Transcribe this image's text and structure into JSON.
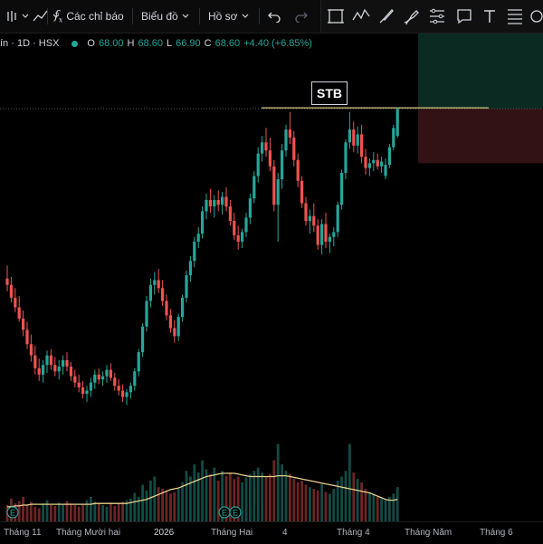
{
  "toolbar": {
    "indicators_label": "Các chỉ báo",
    "chart_label": "Biểu đồ",
    "profile_label": "Hồ sơ"
  },
  "legend": {
    "symbol": "ín · 1D · HSX",
    "o_label": "O",
    "o_value": "68.00",
    "h_label": "H",
    "h_value": "68.60",
    "l_label": "L",
    "l_value": "66.90",
    "c_label": "C",
    "c_value": "68.60",
    "change": "+4.40 (+6.85%)"
  },
  "colors": {
    "up": "#26a69a",
    "down": "#ef5350",
    "ma": "#e8cf8a",
    "target_zone": "#0b2a22",
    "stop_zone": "#331216",
    "entry_line": "#d8c77a"
  },
  "icons": [
    "trend-line-icon",
    "fx-icon",
    "undo-icon",
    "redo-icon",
    "crosshair-box-icon",
    "path-icon",
    "brush-icon",
    "pen-icon",
    "pattern-icon",
    "comment-icon",
    "text-icon",
    "fib-icon",
    "shapes-icon"
  ],
  "chart_data": {
    "type": "candlestick",
    "ticker_label": "STB",
    "x_labels": [
      "Tháng 11",
      "Tháng Mười hai",
      "2026",
      "Tháng Hai",
      "4",
      "Tháng 4",
      "Tháng Năm",
      "Tháng 6"
    ],
    "dividend_marker": "E",
    "price_min": 46,
    "price_max": 72,
    "entry_price": 68.6,
    "target_zone": [
      68.6,
      76
    ],
    "stop_zone": [
      65.2,
      68.6
    ],
    "candles": [
      [
        58.0,
        58.8,
        57.2,
        57.6
      ],
      [
        57.6,
        58.1,
        56.5,
        56.8
      ],
      [
        56.8,
        57.4,
        55.9,
        56.2
      ],
      [
        56.2,
        56.9,
        55.3,
        55.5
      ],
      [
        55.5,
        56.0,
        54.4,
        54.8
      ],
      [
        54.8,
        55.3,
        53.6,
        53.9
      ],
      [
        53.9,
        54.5,
        52.8,
        53.2
      ],
      [
        53.2,
        53.8,
        52.0,
        52.4
      ],
      [
        52.4,
        53.0,
        51.6,
        52.0
      ],
      [
        52.0,
        52.9,
        51.5,
        52.6
      ],
      [
        52.6,
        53.5,
        52.1,
        53.2
      ],
      [
        53.2,
        53.6,
        52.3,
        52.6
      ],
      [
        52.6,
        53.1,
        51.9,
        52.2
      ],
      [
        52.2,
        52.9,
        51.7,
        52.5
      ],
      [
        52.5,
        53.2,
        52.0,
        52.9
      ],
      [
        52.9,
        53.4,
        52.2,
        52.5
      ],
      [
        52.5,
        52.8,
        51.6,
        51.9
      ],
      [
        51.9,
        52.3,
        51.2,
        51.5
      ],
      [
        51.5,
        52.0,
        50.9,
        51.2
      ],
      [
        51.2,
        51.6,
        50.5,
        50.8
      ],
      [
        50.8,
        51.3,
        50.3,
        51.0
      ],
      [
        51.0,
        51.8,
        50.6,
        51.5
      ],
      [
        51.5,
        52.3,
        51.1,
        52.0
      ],
      [
        52.0,
        52.4,
        51.4,
        51.7
      ],
      [
        51.7,
        52.2,
        51.3,
        51.9
      ],
      [
        51.9,
        52.6,
        51.5,
        52.3
      ],
      [
        52.3,
        52.7,
        51.6,
        51.8
      ],
      [
        51.8,
        52.1,
        51.0,
        51.3
      ],
      [
        51.3,
        51.7,
        50.7,
        51.0
      ],
      [
        51.0,
        51.4,
        50.3,
        50.6
      ],
      [
        50.6,
        51.1,
        50.1,
        50.9
      ],
      [
        50.9,
        51.5,
        50.5,
        51.3
      ],
      [
        51.3,
        52.4,
        51.0,
        52.2
      ],
      [
        52.2,
        53.6,
        51.9,
        53.4
      ],
      [
        53.4,
        55.2,
        53.1,
        55.0
      ],
      [
        55.0,
        56.9,
        54.7,
        56.6
      ],
      [
        56.6,
        58.0,
        56.2,
        57.6
      ],
      [
        57.6,
        58.4,
        57.0,
        57.9
      ],
      [
        57.9,
        58.6,
        57.1,
        57.4
      ],
      [
        57.4,
        57.9,
        56.3,
        56.6
      ],
      [
        56.6,
        57.0,
        55.4,
        55.7
      ],
      [
        55.7,
        56.1,
        54.6,
        54.9
      ],
      [
        54.9,
        55.4,
        54.0,
        54.4
      ],
      [
        54.4,
        55.8,
        54.1,
        55.6
      ],
      [
        55.6,
        57.0,
        55.3,
        56.8
      ],
      [
        56.8,
        58.5,
        56.5,
        58.2
      ],
      [
        58.2,
        59.4,
        57.8,
        59.1
      ],
      [
        59.1,
        60.6,
        58.7,
        60.3
      ],
      [
        60.3,
        61.2,
        59.9,
        60.8
      ],
      [
        60.8,
        62.5,
        60.5,
        62.2
      ],
      [
        62.2,
        63.3,
        61.7,
        62.9
      ],
      [
        62.9,
        63.6,
        62.1,
        62.5
      ],
      [
        62.5,
        63.2,
        61.8,
        62.9
      ],
      [
        62.9,
        63.5,
        62.2,
        62.6
      ],
      [
        62.6,
        63.4,
        62.0,
        63.1
      ],
      [
        63.1,
        63.7,
        62.2,
        62.5
      ],
      [
        62.5,
        62.9,
        61.3,
        61.6
      ],
      [
        61.6,
        62.1,
        60.4,
        60.7
      ],
      [
        60.7,
        61.3,
        59.8,
        60.3
      ],
      [
        60.3,
        61.1,
        59.9,
        60.9
      ],
      [
        60.9,
        62.1,
        60.6,
        61.8
      ],
      [
        61.8,
        63.3,
        61.4,
        63.0
      ],
      [
        63.0,
        64.7,
        62.7,
        64.4
      ],
      [
        64.4,
        66.2,
        64.0,
        65.8
      ],
      [
        65.8,
        66.9,
        65.3,
        66.5
      ],
      [
        66.5,
        67.4,
        65.6,
        66.0
      ],
      [
        66.0,
        66.8,
        64.7,
        65.0
      ],
      [
        65.0,
        65.4,
        62.2,
        62.6
      ],
      [
        62.6,
        64.6,
        60.3,
        64.2
      ],
      [
        64.2,
        66.4,
        63.6,
        66.0
      ],
      [
        66.0,
        67.6,
        65.6,
        67.3
      ],
      [
        67.3,
        68.4,
        66.4,
        66.8
      ],
      [
        66.8,
        67.2,
        65.0,
        65.4
      ],
      [
        65.4,
        65.8,
        63.7,
        64.1
      ],
      [
        64.1,
        64.4,
        62.4,
        62.7
      ],
      [
        62.7,
        63.1,
        61.3,
        61.6
      ],
      [
        61.6,
        62.3,
        60.8,
        61.9
      ],
      [
        61.9,
        62.7,
        60.9,
        61.3
      ],
      [
        61.3,
        61.7,
        59.8,
        60.1
      ],
      [
        60.1,
        61.7,
        59.5,
        61.4
      ],
      [
        61.4,
        62.1,
        59.9,
        60.3
      ],
      [
        60.3,
        60.8,
        59.6,
        60.6
      ],
      [
        60.6,
        61.2,
        60.0,
        60.9
      ],
      [
        60.9,
        62.8,
        60.6,
        62.6
      ],
      [
        62.6,
        64.8,
        62.3,
        64.6
      ],
      [
        64.6,
        66.7,
        64.2,
        66.5
      ],
      [
        66.5,
        68.4,
        66.1,
        67.3
      ],
      [
        67.3,
        67.8,
        65.9,
        66.3
      ],
      [
        66.3,
        67.5,
        65.8,
        67.0
      ],
      [
        67.0,
        67.6,
        65.2,
        65.6
      ],
      [
        65.6,
        66.1,
        64.5,
        64.9
      ],
      [
        64.9,
        65.5,
        64.4,
        65.2
      ],
      [
        65.2,
        65.9,
        64.7,
        65.4
      ],
      [
        65.4,
        65.8,
        64.8,
        65.0
      ],
      [
        65.0,
        65.6,
        64.6,
        65.3
      ],
      [
        64.4,
        65.5,
        64.2,
        65.1
      ],
      [
        65.1,
        66.4,
        64.9,
        66.2
      ],
      [
        66.2,
        67.6,
        66.0,
        67.4
      ],
      [
        66.9,
        68.7,
        66.8,
        68.6
      ]
    ],
    "volumes": [
      0.2,
      0.28,
      0.22,
      0.25,
      0.3,
      0.2,
      0.24,
      0.18,
      0.16,
      0.22,
      0.26,
      0.2,
      0.19,
      0.23,
      0.21,
      0.25,
      0.22,
      0.2,
      0.18,
      0.21,
      0.26,
      0.3,
      0.24,
      0.22,
      0.2,
      0.18,
      0.23,
      0.19,
      0.22,
      0.24,
      0.26,
      0.28,
      0.35,
      0.3,
      0.45,
      0.38,
      0.5,
      0.55,
      0.42,
      0.4,
      0.38,
      0.34,
      0.36,
      0.4,
      0.48,
      0.62,
      0.55,
      0.7,
      0.6,
      0.75,
      0.64,
      0.58,
      0.66,
      0.5,
      0.62,
      0.56,
      0.6,
      0.52,
      0.55,
      0.48,
      0.54,
      0.58,
      0.62,
      0.66,
      0.6,
      0.55,
      0.58,
      0.75,
      0.95,
      0.7,
      0.62,
      0.58,
      0.52,
      0.48,
      0.5,
      0.45,
      0.42,
      0.4,
      0.38,
      0.46,
      0.36,
      0.34,
      0.4,
      0.5,
      0.55,
      0.62,
      0.95,
      0.6,
      0.52,
      0.48,
      0.4,
      0.36,
      0.34,
      0.3,
      0.28,
      0.26,
      0.3,
      0.34,
      0.42
    ],
    "ma_volume": [
      0.18,
      0.18,
      0.19,
      0.19,
      0.2,
      0.2,
      0.21,
      0.21,
      0.21,
      0.21,
      0.21,
      0.21,
      0.21,
      0.21,
      0.21,
      0.21,
      0.21,
      0.21,
      0.21,
      0.21,
      0.21,
      0.21,
      0.22,
      0.22,
      0.22,
      0.22,
      0.22,
      0.22,
      0.22,
      0.22,
      0.22,
      0.23,
      0.24,
      0.25,
      0.26,
      0.27,
      0.29,
      0.31,
      0.33,
      0.35,
      0.37,
      0.39,
      0.4,
      0.41,
      0.43,
      0.45,
      0.47,
      0.49,
      0.51,
      0.53,
      0.55,
      0.56,
      0.57,
      0.58,
      0.59,
      0.59,
      0.59,
      0.59,
      0.58,
      0.57,
      0.56,
      0.55,
      0.55,
      0.55,
      0.55,
      0.55,
      0.55,
      0.55,
      0.56,
      0.56,
      0.56,
      0.55,
      0.54,
      0.53,
      0.52,
      0.51,
      0.5,
      0.49,
      0.48,
      0.47,
      0.46,
      0.45,
      0.44,
      0.43,
      0.42,
      0.41,
      0.4,
      0.39,
      0.38,
      0.37,
      0.36,
      0.35,
      0.33,
      0.31,
      0.29,
      0.27,
      0.26,
      0.26,
      0.27
    ]
  }
}
